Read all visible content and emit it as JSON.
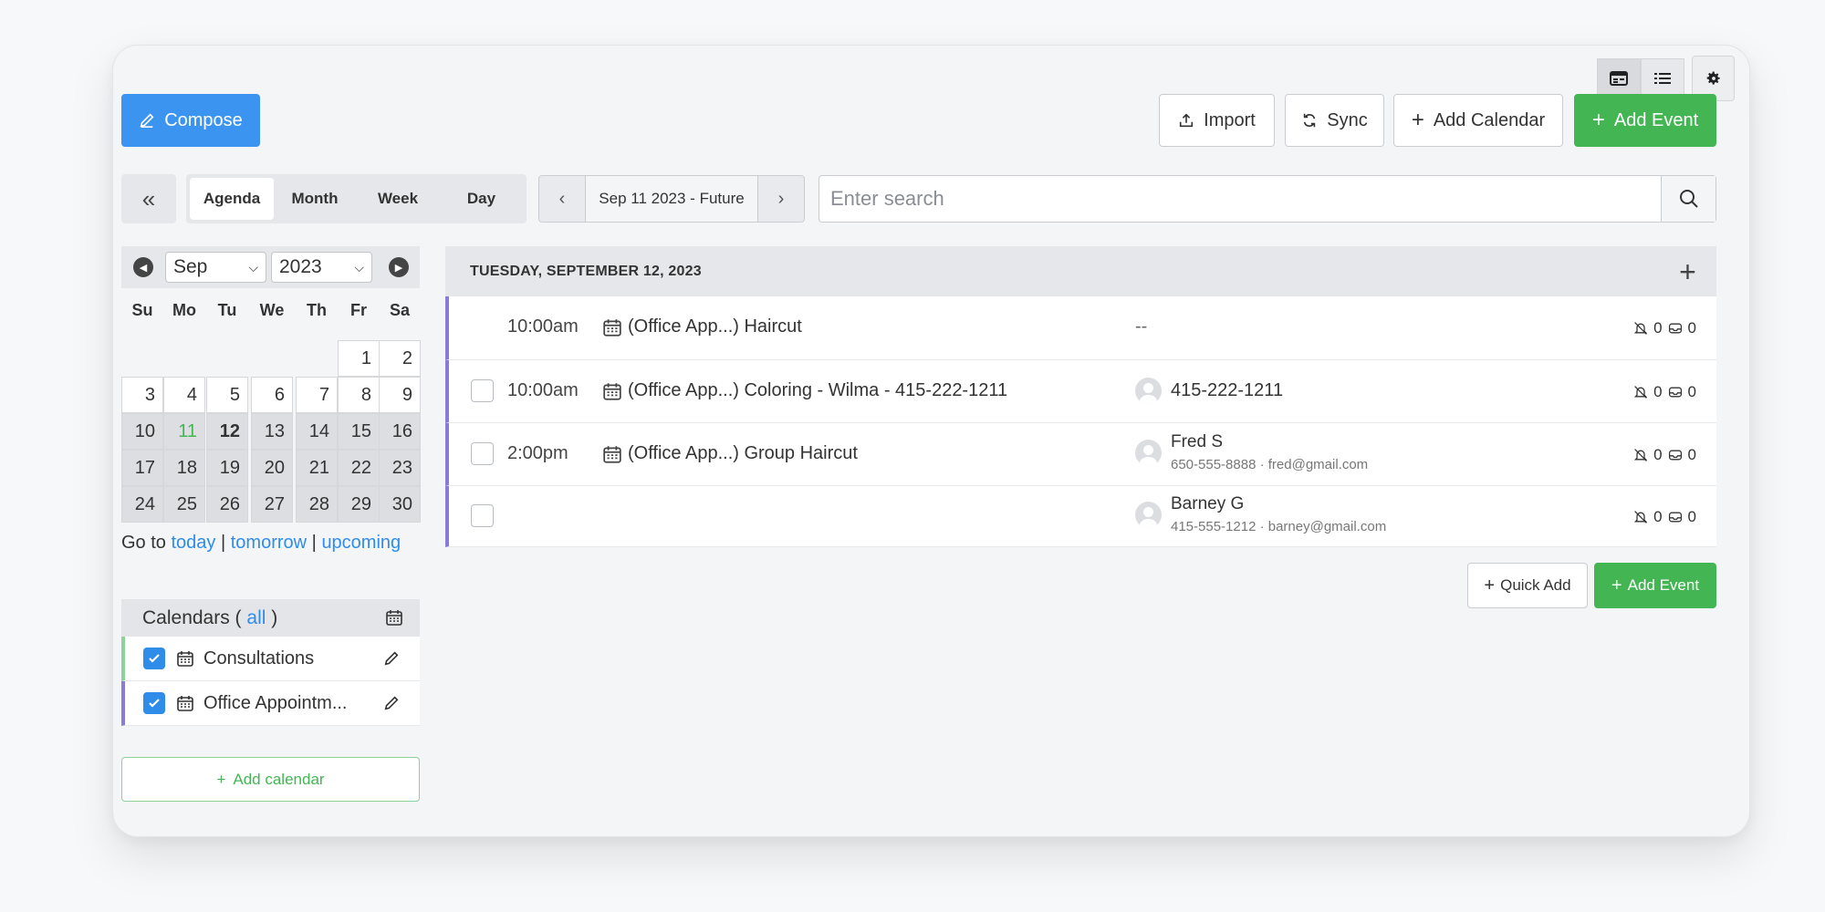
{
  "toolbar": {
    "compose": "Compose",
    "import": "Import",
    "sync": "Sync",
    "add_calendar": "Add Calendar",
    "add_event": "Add Event"
  },
  "views": {
    "tabs": [
      "Agenda",
      "Month",
      "Week",
      "Day"
    ],
    "active": "Agenda",
    "range_label": "Sep 11 2023 - Future"
  },
  "search": {
    "placeholder": "Enter search"
  },
  "mini_calendar": {
    "month": "Sep",
    "year": "2023",
    "weekdays": [
      "Su",
      "Mo",
      "Tu",
      "We",
      "Th",
      "Fr",
      "Sa"
    ],
    "today": "11",
    "selected": "12"
  },
  "goto": {
    "prefix": "Go to",
    "today": "today",
    "sep": "|",
    "tomorrow": "tomorrow",
    "upcoming": "upcoming"
  },
  "calendars": {
    "title_prefix": "Calendars (",
    "all": "all",
    "title_suffix": ")",
    "items": [
      {
        "name": "Consultations",
        "color": "#8fd19a",
        "checked": true
      },
      {
        "name": "Office Appointm...",
        "color": "#8b7bd8",
        "checked": true
      }
    ],
    "add_label": "Add calendar"
  },
  "agenda": {
    "day_header": "TUESDAY, SEPTEMBER 12, 2023",
    "events": [
      {
        "time": "10:00am",
        "title": "(Office App...) Haircut",
        "contact": "--",
        "alerts": "0",
        "messages": "0"
      },
      {
        "time": "10:00am",
        "title": "(Office App...) Coloring - Wilma - 415-222-1211",
        "contact": "415-222-1211",
        "alerts": "0",
        "messages": "0"
      },
      {
        "time": "2:00pm",
        "title": "(Office App...) Group Haircut",
        "contact": "Fred S",
        "contact_sub": "650-555-8888 · fred@gmail.com",
        "alerts": "0",
        "messages": "0"
      },
      {
        "time": "",
        "title": "",
        "contact": "Barney G",
        "contact_sub": "415-555-1212 · barney@gmail.com",
        "alerts": "0",
        "messages": "0"
      }
    ],
    "quick_add": "Quick Add",
    "add_event": "Add Event"
  },
  "colors": {
    "primary": "#3b95f0",
    "success": "#43b653",
    "event_bar": "#8b7bd8"
  }
}
